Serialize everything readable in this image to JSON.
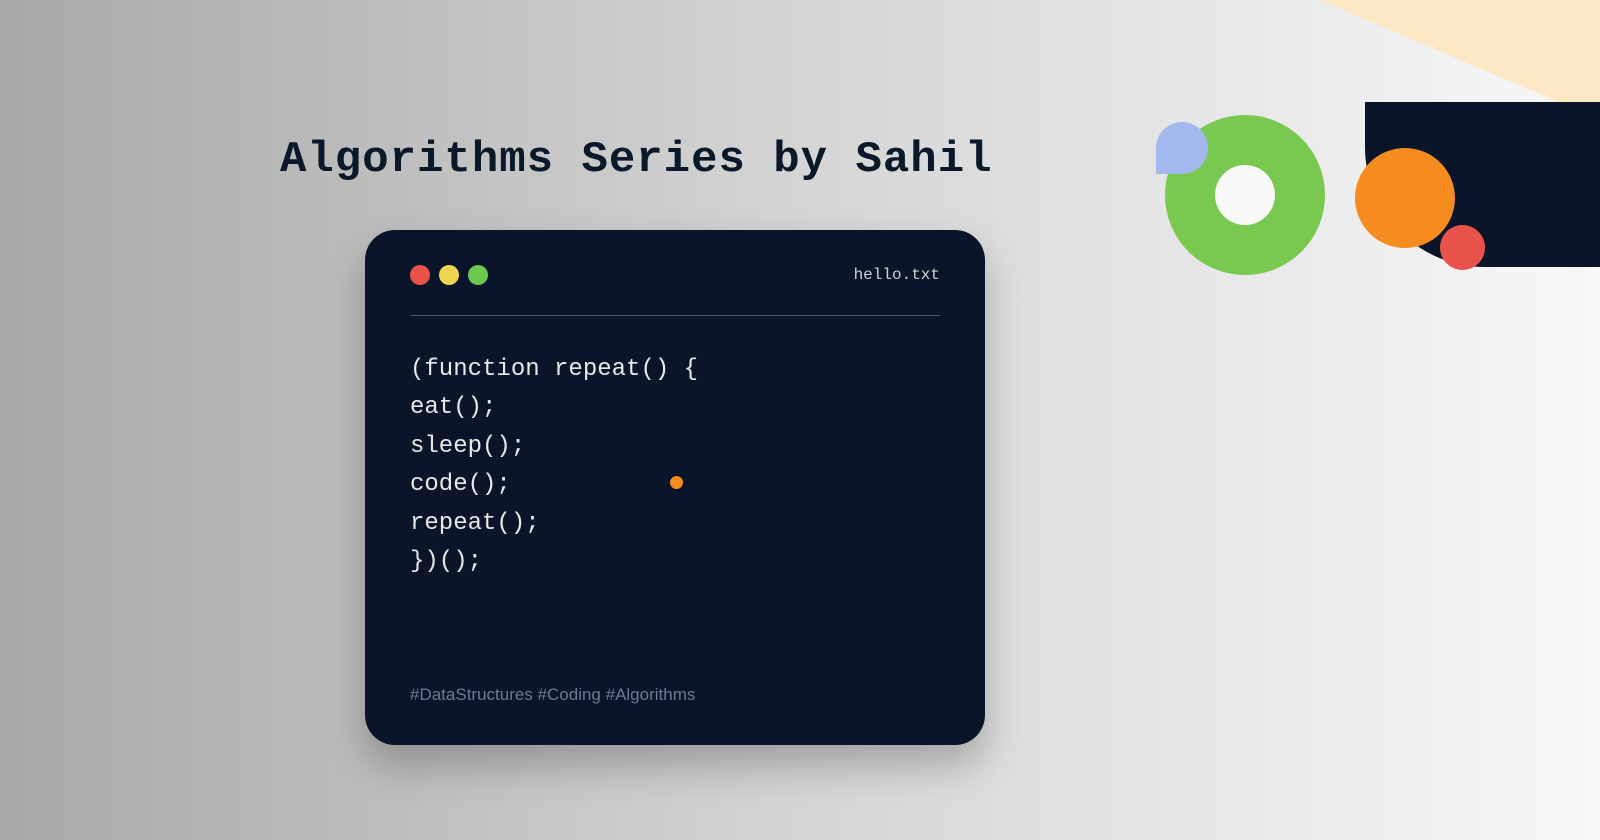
{
  "title": "Algorithms Series by Sahil",
  "window": {
    "filename": "hello.txt",
    "code_lines": [
      "(function repeat() {",
      "eat();",
      "sleep();",
      "code();",
      "repeat();",
      "})();"
    ],
    "hashtags": "#DataStructures #Coding #Algorithms"
  }
}
